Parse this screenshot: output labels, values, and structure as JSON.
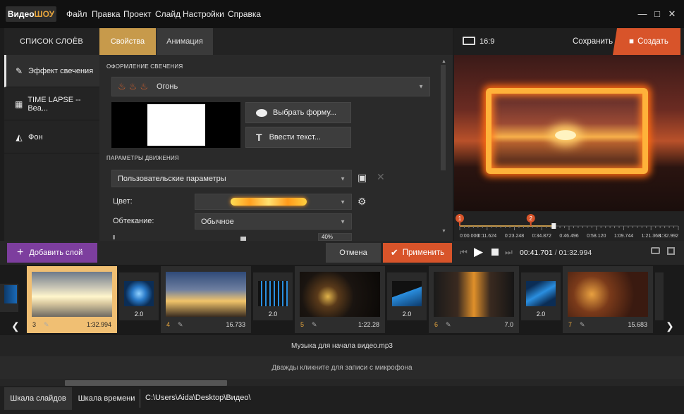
{
  "app": {
    "logo_a": "Видео",
    "logo_b": "ШОУ"
  },
  "menu": [
    "Файл",
    "Правка",
    "Проект",
    "Слайд",
    "Настройки",
    "Справка"
  ],
  "window": {
    "min": "—",
    "max": "□",
    "close": "✕"
  },
  "tabs": {
    "layers_title": "СПИСОК СЛОЁВ",
    "properties": "Свойства",
    "animation": "Анимация"
  },
  "layers": [
    {
      "label": "Эффект свечения",
      "icon": "wand-icon"
    },
    {
      "label": "TIME LAPSE -- Bea...",
      "icon": "clapper-icon"
    },
    {
      "label": "Фон",
      "icon": "paint-bucket-icon"
    }
  ],
  "glow": {
    "section": "ОФОРМЛЕНИЕ СВЕЧЕНИЯ",
    "preset": "Огонь",
    "choose_shape": "Выбрать форму...",
    "enter_text": "Ввести текст..."
  },
  "motion": {
    "section": "ПАРАМЕТРЫ ДВИЖЕНИЯ",
    "preset": "Пользовательские параметры",
    "color_label": "Цвет:",
    "flow_label": "Обтекание:",
    "flow_value": "Обычное",
    "partial_value": "40%"
  },
  "preview": {
    "ratio": "16:9",
    "save": "Сохранить",
    "create": "Создать"
  },
  "timeline": {
    "markers": [
      "1",
      "2"
    ],
    "ticks": [
      "0:00.000",
      "0:11.624",
      "0:23.248",
      "0:34.872",
      "0:46.496",
      "0:58.120",
      "1:09.744",
      "1:21.368",
      "1:32.992"
    ],
    "position": 0.43,
    "time_current": "00:41.701",
    "time_sep": " / ",
    "time_total": "01:32.994"
  },
  "actions": {
    "add_layer": "Добавить слой",
    "cancel": "Отмена",
    "apply": "Применить"
  },
  "slides": [
    {
      "num": "3",
      "dur": "1:32.994",
      "selected": true
    },
    {
      "num": "4",
      "dur": "16.733"
    },
    {
      "num": "5",
      "dur": "1:22.28"
    },
    {
      "num": "6",
      "dur": "7.0"
    },
    {
      "num": "7",
      "dur": "15.683"
    }
  ],
  "transitions": [
    "2.0",
    "2.0",
    "2.0",
    "2.0"
  ],
  "audio": {
    "music": "Музыка для начала видео.mp3",
    "mic": "Дважды кликните для записи с микрофона"
  },
  "bottom": {
    "tab_slides": "Шкала слайдов",
    "tab_time": "Шкала времени",
    "path": "C:\\Users\\Aida\\Desktop\\Видео\\"
  },
  "colors": {
    "accent_gold": "#c79a4b",
    "accent_orange": "#d8542a",
    "accent_purple": "#7d3e9e"
  }
}
